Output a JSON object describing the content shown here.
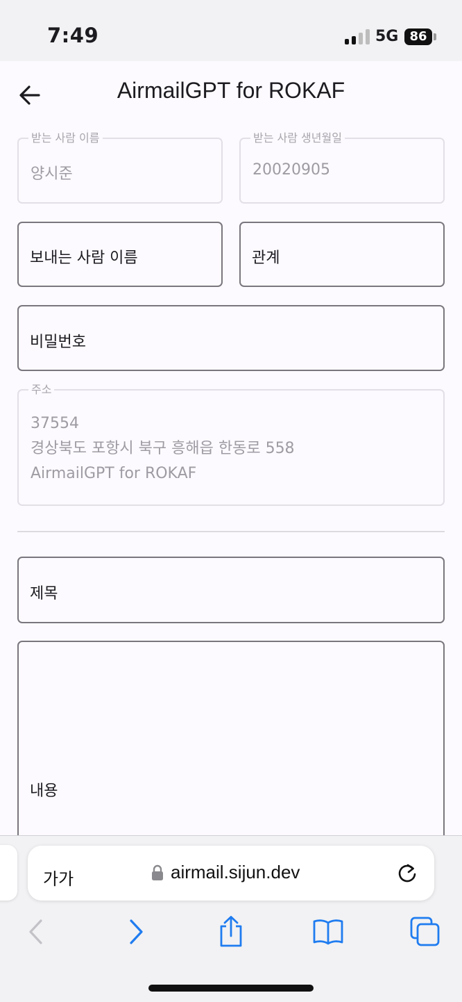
{
  "status_bar": {
    "time": "7:49",
    "network": "5G",
    "battery": "86"
  },
  "app_bar": {
    "title": "AirmailGPT for ROKAF",
    "back_icon": "arrow-left-icon"
  },
  "form": {
    "recipient_name": {
      "label": "받는 사람 이름",
      "value": "양시준"
    },
    "recipient_birth": {
      "label": "받는 사람 생년월일",
      "value": "20020905"
    },
    "sender_name": {
      "placeholder": "보내는 사람 이름"
    },
    "relationship": {
      "placeholder": "관계"
    },
    "password": {
      "placeholder": "비밀번호"
    },
    "address": {
      "label": "주소",
      "lines": [
        "37554",
        "경상북도 포항시 북구 흥해읍 한동로 558",
        "AirmailGPT for ROKAF"
      ]
    },
    "subject": {
      "placeholder": "제목"
    },
    "content": {
      "placeholder": "내용"
    }
  },
  "browser": {
    "text_size_label": "가가",
    "url": "airmail.sijun.dev",
    "icons": [
      "lock-icon",
      "reload-icon",
      "back-icon",
      "forward-icon",
      "share-icon",
      "bookmarks-icon",
      "tabs-icon"
    ]
  },
  "colors": {
    "background": "#fcfaff",
    "outline_enabled": "#79767d",
    "outline_disabled": "#e2e0e6",
    "safari_blue": "#1f7cf0"
  }
}
